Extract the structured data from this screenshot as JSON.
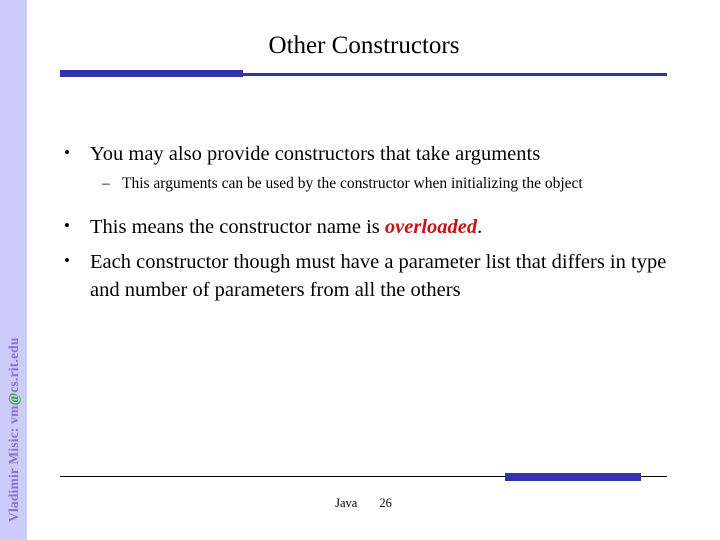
{
  "slide": {
    "title": "Other Constructors",
    "accent_color": "#3333aa",
    "background_color": "#ffffff"
  },
  "sidebar": {
    "author_prefix": "Vladimir Misic: vm",
    "at_symbol": "@",
    "author_domain": "cs.rit.edu",
    "text_color": "#8e71c7",
    "at_color": "#23a03a",
    "background_color": "#ccccfa"
  },
  "content": {
    "bullets": [
      {
        "level": 1,
        "marker": "•",
        "text": "You may also provide constructors that take arguments"
      },
      {
        "level": 2,
        "marker": "–",
        "text": "This arguments can be used by the constructor when initializing the object"
      },
      {
        "level": 1,
        "marker": "•",
        "text_before": "This means the  constructor name is ",
        "emphasis": "overloaded",
        "emphasis_color": "#cc1111",
        "text_after": "."
      },
      {
        "level": 1,
        "marker": "•",
        "text": "Each constructor though must have a parameter list that differs in type and number of parameters from all the others"
      }
    ]
  },
  "footer": {
    "label": "Java",
    "slide_number": "26"
  }
}
